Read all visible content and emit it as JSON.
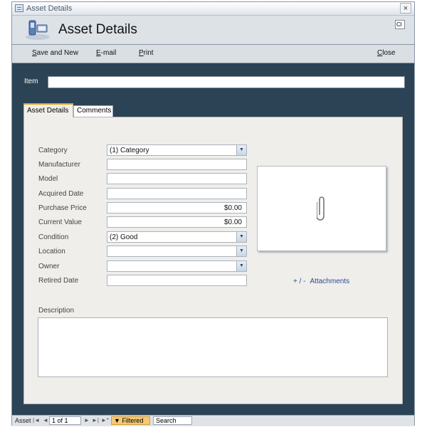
{
  "window": {
    "title": "Asset Details",
    "close_glyph": "×"
  },
  "ribbon_fragment": "Cl",
  "header": {
    "title": "Asset Details",
    "logo_icon": "asset-devices-icon"
  },
  "toolbar": {
    "save_and_new": {
      "underlined": "S",
      "rest": "ave and New"
    },
    "email": {
      "underlined": "E",
      "rest": "-mail"
    },
    "print": {
      "underlined": "P",
      "rest": "rint"
    },
    "close": {
      "underlined": "C",
      "rest": "lose"
    }
  },
  "item": {
    "label": "Item",
    "value": ""
  },
  "tabs": [
    {
      "label": "Asset Details",
      "active": true
    },
    {
      "label": "Comments",
      "active": false
    }
  ],
  "fields": {
    "category": {
      "label": "Category",
      "value": "(1) Category"
    },
    "manufacturer": {
      "label": "Manufacturer",
      "value": ""
    },
    "model": {
      "label": "Model",
      "value": ""
    },
    "acquired_date": {
      "label": "Acquired Date",
      "value": ""
    },
    "purchase_price": {
      "label": "Purchase Price",
      "value": "$0.00"
    },
    "current_value": {
      "label": "Current Value",
      "value": "$0.00"
    },
    "condition": {
      "label": "Condition",
      "value": "(2) Good"
    },
    "location": {
      "label": "Location",
      "value": ""
    },
    "owner": {
      "label": "Owner",
      "value": ""
    },
    "retired_date": {
      "label": "Retired Date",
      "value": ""
    }
  },
  "attachments": {
    "plusminus": "+ / -",
    "label": "Attachments",
    "icon": "paperclip-icon"
  },
  "description": {
    "label": "Description",
    "value": ""
  },
  "statusbar": {
    "record_label": "Asset",
    "first_glyph": "|◄",
    "prev_glyph": "◄",
    "record_position": "1 of 1",
    "next_glyph": "►",
    "last_glyph": "►|",
    "new_glyph": "►*",
    "filter_label": "Filtered",
    "search_label": "Search"
  },
  "colors": {
    "form_background": "#2b4355",
    "tab_accent": "#e3a21a",
    "filter_badge": "#f5c872",
    "link": "#2a4a93"
  }
}
